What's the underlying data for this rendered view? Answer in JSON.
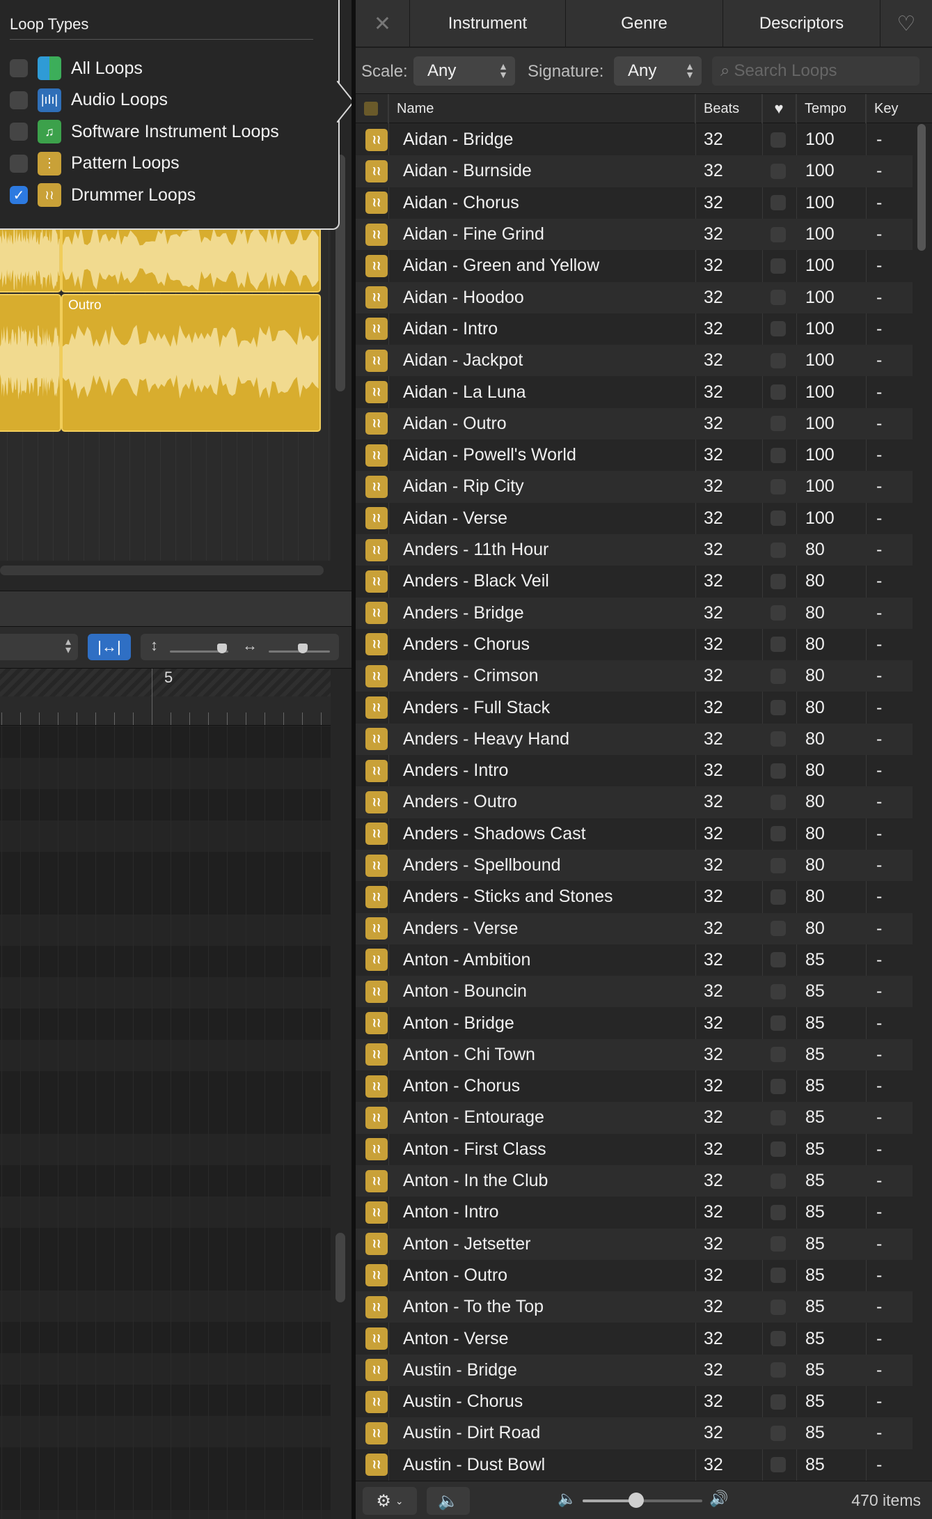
{
  "loop_types": {
    "title": "Loop Types",
    "items": [
      {
        "label": "All Loops",
        "checked": false,
        "icon": "all-loops-icon"
      },
      {
        "label": "Audio Loops",
        "checked": false,
        "icon": "audio-waveform-icon"
      },
      {
        "label": "Software Instrument Loops",
        "checked": false,
        "icon": "music-note-icon"
      },
      {
        "label": "Pattern Loops",
        "checked": false,
        "icon": "pattern-grid-icon"
      },
      {
        "label": "Drummer Loops",
        "checked": true,
        "icon": "drummer-icon"
      }
    ]
  },
  "tracks": {
    "region_label": "Outro",
    "region_color": "#d8ad2e"
  },
  "editor": {
    "ruler_bar": "5"
  },
  "browser": {
    "tabs": {
      "instrument": "Instrument",
      "genre": "Genre",
      "descriptors": "Descriptors"
    },
    "filters": {
      "scale_label": "Scale:",
      "scale_value": "Any",
      "signature_label": "Signature:",
      "signature_value": "Any",
      "search_placeholder": "Search Loops"
    },
    "columns": {
      "name": "Name",
      "beats": "Beats",
      "tempo": "Tempo",
      "key": "Key"
    },
    "rows": [
      {
        "name": "Aidan - Bridge",
        "beats": "32",
        "tempo": "100",
        "key": "-"
      },
      {
        "name": "Aidan - Burnside",
        "beats": "32",
        "tempo": "100",
        "key": "-"
      },
      {
        "name": "Aidan - Chorus",
        "beats": "32",
        "tempo": "100",
        "key": "-"
      },
      {
        "name": "Aidan - Fine Grind",
        "beats": "32",
        "tempo": "100",
        "key": "-"
      },
      {
        "name": "Aidan - Green and Yellow",
        "beats": "32",
        "tempo": "100",
        "key": "-"
      },
      {
        "name": "Aidan - Hoodoo",
        "beats": "32",
        "tempo": "100",
        "key": "-"
      },
      {
        "name": "Aidan - Intro",
        "beats": "32",
        "tempo": "100",
        "key": "-"
      },
      {
        "name": "Aidan - Jackpot",
        "beats": "32",
        "tempo": "100",
        "key": "-"
      },
      {
        "name": "Aidan - La Luna",
        "beats": "32",
        "tempo": "100",
        "key": "-"
      },
      {
        "name": "Aidan - Outro",
        "beats": "32",
        "tempo": "100",
        "key": "-"
      },
      {
        "name": "Aidan - Powell's World",
        "beats": "32",
        "tempo": "100",
        "key": "-"
      },
      {
        "name": "Aidan - Rip City",
        "beats": "32",
        "tempo": "100",
        "key": "-"
      },
      {
        "name": "Aidan - Verse",
        "beats": "32",
        "tempo": "100",
        "key": "-"
      },
      {
        "name": "Anders - 11th Hour",
        "beats": "32",
        "tempo": "80",
        "key": "-"
      },
      {
        "name": "Anders - Black Veil",
        "beats": "32",
        "tempo": "80",
        "key": "-"
      },
      {
        "name": "Anders - Bridge",
        "beats": "32",
        "tempo": "80",
        "key": "-"
      },
      {
        "name": "Anders - Chorus",
        "beats": "32",
        "tempo": "80",
        "key": "-"
      },
      {
        "name": "Anders - Crimson",
        "beats": "32",
        "tempo": "80",
        "key": "-"
      },
      {
        "name": "Anders - Full Stack",
        "beats": "32",
        "tempo": "80",
        "key": "-"
      },
      {
        "name": "Anders - Heavy Hand",
        "beats": "32",
        "tempo": "80",
        "key": "-"
      },
      {
        "name": "Anders - Intro",
        "beats": "32",
        "tempo": "80",
        "key": "-"
      },
      {
        "name": "Anders - Outro",
        "beats": "32",
        "tempo": "80",
        "key": "-"
      },
      {
        "name": "Anders - Shadows Cast",
        "beats": "32",
        "tempo": "80",
        "key": "-"
      },
      {
        "name": "Anders - Spellbound",
        "beats": "32",
        "tempo": "80",
        "key": "-"
      },
      {
        "name": "Anders - Sticks and Stones",
        "beats": "32",
        "tempo": "80",
        "key": "-"
      },
      {
        "name": "Anders - Verse",
        "beats": "32",
        "tempo": "80",
        "key": "-"
      },
      {
        "name": "Anton - Ambition",
        "beats": "32",
        "tempo": "85",
        "key": "-"
      },
      {
        "name": "Anton - Bouncin",
        "beats": "32",
        "tempo": "85",
        "key": "-"
      },
      {
        "name": "Anton - Bridge",
        "beats": "32",
        "tempo": "85",
        "key": "-"
      },
      {
        "name": "Anton - Chi Town",
        "beats": "32",
        "tempo": "85",
        "key": "-"
      },
      {
        "name": "Anton - Chorus",
        "beats": "32",
        "tempo": "85",
        "key": "-"
      },
      {
        "name": "Anton - Entourage",
        "beats": "32",
        "tempo": "85",
        "key": "-"
      },
      {
        "name": "Anton - First Class",
        "beats": "32",
        "tempo": "85",
        "key": "-"
      },
      {
        "name": "Anton - In the Club",
        "beats": "32",
        "tempo": "85",
        "key": "-"
      },
      {
        "name": "Anton - Intro",
        "beats": "32",
        "tempo": "85",
        "key": "-"
      },
      {
        "name": "Anton - Jetsetter",
        "beats": "32",
        "tempo": "85",
        "key": "-"
      },
      {
        "name": "Anton - Outro",
        "beats": "32",
        "tempo": "85",
        "key": "-"
      },
      {
        "name": "Anton - To the Top",
        "beats": "32",
        "tempo": "85",
        "key": "-"
      },
      {
        "name": "Anton - Verse",
        "beats": "32",
        "tempo": "85",
        "key": "-"
      },
      {
        "name": "Austin - Bridge",
        "beats": "32",
        "tempo": "85",
        "key": "-"
      },
      {
        "name": "Austin - Chorus",
        "beats": "32",
        "tempo": "85",
        "key": "-"
      },
      {
        "name": "Austin - Dirt Road",
        "beats": "32",
        "tempo": "85",
        "key": "-"
      },
      {
        "name": "Austin - Dust Bowl",
        "beats": "32",
        "tempo": "85",
        "key": "-"
      }
    ],
    "footer": {
      "item_count": "470 items",
      "volume_level": 0.45
    },
    "colors": {
      "loop_icon": "#c9a138",
      "accent": "#2d7ae0"
    }
  }
}
